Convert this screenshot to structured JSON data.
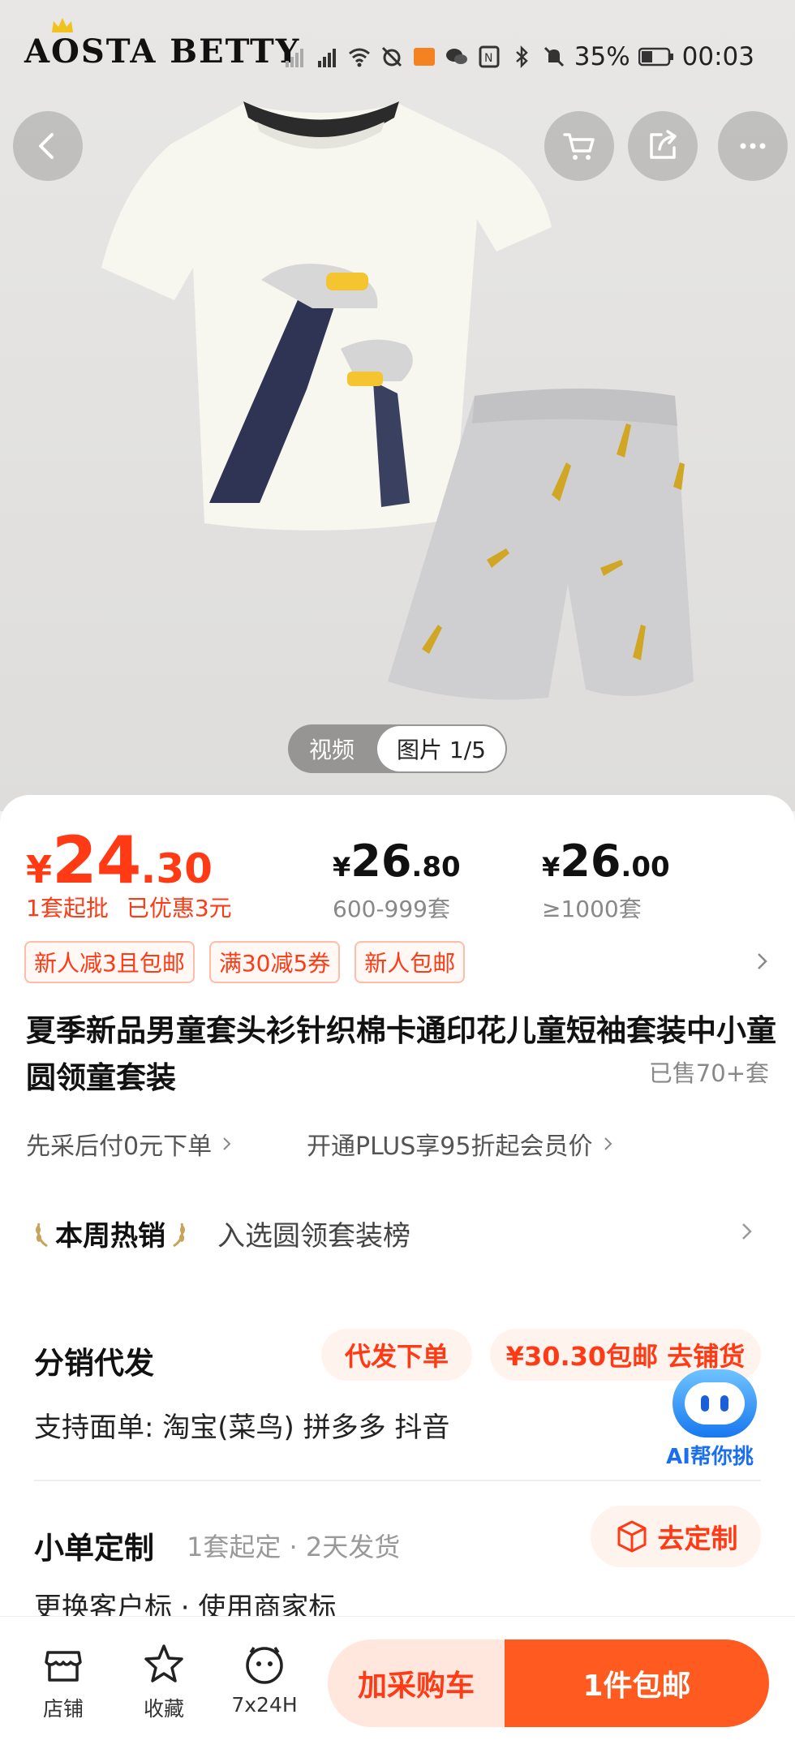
{
  "status_bar": {
    "brand": "AOSTA BETTY",
    "battery": "35%",
    "time": "00:03"
  },
  "hero": {
    "video_tab": "视频",
    "image_tab": "图片 1/5"
  },
  "price": {
    "currency": "¥",
    "integer": "24",
    "decimal": ".30",
    "min_order": "1套起批",
    "discount": "已优惠3元",
    "tiers": [
      {
        "currency": "¥",
        "integer": "26",
        "decimal": ".80",
        "qty": "600-999套"
      },
      {
        "currency": "¥",
        "integer": "26",
        "decimal": ".00",
        "qty": "≥1000套"
      }
    ]
  },
  "promos": [
    "新人减3且包邮",
    "满30减5券",
    "新人包邮"
  ],
  "product": {
    "title": "夏季新品男童套头衫针织棉卡通印花儿童短袖套装中小童圆领童套装",
    "sold": "已售70+套"
  },
  "services": {
    "pay_later": "先采后付0元下单",
    "plus": "开通PLUS享95折起会员价"
  },
  "hot": {
    "badge": "本周热销",
    "text": "入选圆领套装榜"
  },
  "distribution": {
    "title": "分销代发",
    "order_button": "代发下单",
    "stock_button": "¥30.30包邮 去铺货",
    "support": "支持面单:  淘宝(菜鸟) 拼多多 抖音",
    "custom_title": "小单定制",
    "custom_meta": "1套起定 · 2天发货",
    "custom_button": "去定制",
    "custom_sub": "更换客户标  ·  使用商家标"
  },
  "ai": {
    "label": "AI帮你挑"
  },
  "bottom_bar": {
    "shop": "店铺",
    "favorite": "收藏",
    "service": "7x24H",
    "cart_button": "加采购车",
    "buy_button": "1件包邮"
  },
  "colors": {
    "accent": "#ff3a14",
    "buy": "#ff5a1f",
    "cart_bg": "#ffe7dd",
    "ai_blue": "#1a6ef0"
  }
}
